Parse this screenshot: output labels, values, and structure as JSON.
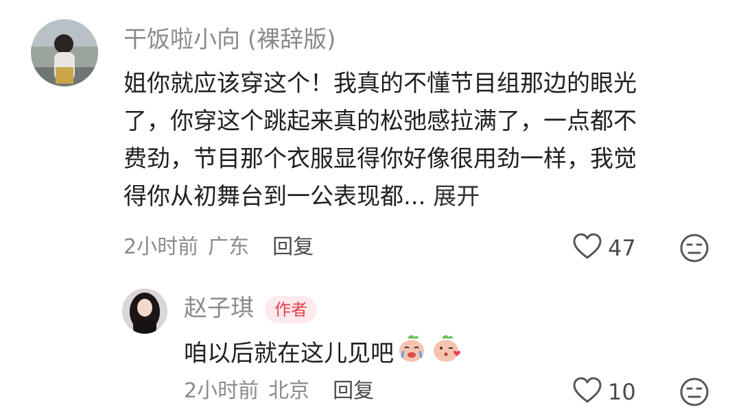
{
  "comment": {
    "username": "干饭啦小向 (裸辞版)",
    "lines": [
      "姐你就应该穿这个！我真的不懂节目组那边的眼光",
      "了，你穿这个跳起来真的松弛感拉满了，一点都不",
      "费劲，节目那个衣服显得你好像很用劲一样，我觉",
      "得你从初舞台到一公表现都..."
    ],
    "expand_label": "展开",
    "time": "2小时前",
    "location": "广东",
    "reply_label": "回复",
    "likes": "47"
  },
  "reply": {
    "username": "赵子琪",
    "badge": "作者",
    "text": "咱以后就在这儿见吧",
    "time": "2小时前",
    "location": "北京",
    "reply_label": "回复",
    "likes": "10"
  },
  "icons": {
    "like": "heart-outline-icon",
    "dislike": "meh-face-icon",
    "emoji1": "crying-peach-emoji",
    "emoji2": "kiss-peach-emoji"
  }
}
